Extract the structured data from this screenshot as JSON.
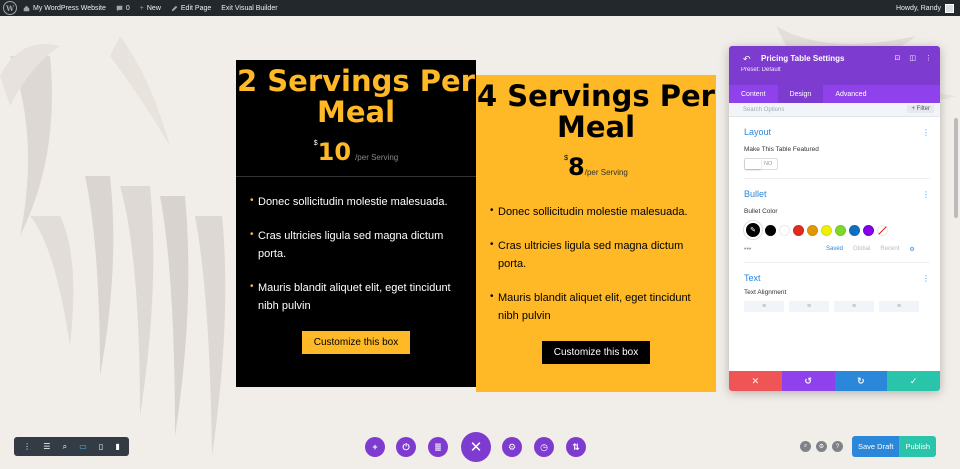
{
  "admin_bar": {
    "site_name": "My WordPress Website",
    "comments_count": "0",
    "new_label": "New",
    "edit_page_label": "Edit Page",
    "exit_builder_label": "Exit Visual Builder",
    "greeting": "Howdy, Randy"
  },
  "pricing_tables": [
    {
      "title": "2 Servings Per Meal",
      "currency": "$",
      "price": "10",
      "per": "/per Serving",
      "features": [
        "Donec sollicitudin molestie malesuada.",
        "Cras ultricies ligula sed magna dictum porta.",
        "Mauris blandit aliquet elit, eget tincidunt nibh pulvin"
      ],
      "button": "Customize this box"
    },
    {
      "title": "4 Servings Per Meal",
      "currency": "$",
      "price": "8",
      "per": "/per Serving",
      "features": [
        "Donec sollicitudin molestie malesuada.",
        "Cras ultricies ligula sed magna dictum porta.",
        "Mauris blandit aliquet elit, eget tincidunt nibh pulvin"
      ],
      "button": "Customize this box"
    }
  ],
  "settings_panel": {
    "title": "Pricing Table Settings",
    "preset": "Preset: Default",
    "tabs": [
      "Content",
      "Design",
      "Advanced"
    ],
    "active_tab": "Design",
    "search_placeholder": "Search Options",
    "filter_label": "Filter",
    "layout_section": {
      "title": "Layout",
      "featured_label": "Make This Table Featured",
      "featured_value": "NO"
    },
    "bullet_section": {
      "title": "Bullet",
      "color_label": "Bullet Color",
      "swatches": [
        "#000000",
        "#ffffff",
        "#e02b20",
        "#e09900",
        "#edf000",
        "#7cda24",
        "#0c71c3",
        "#8300e9"
      ],
      "palette_tabs": [
        "Saved",
        "Global",
        "Recent"
      ],
      "active_palette_tab": "Saved",
      "more": "•••"
    },
    "text_section": {
      "title": "Text",
      "alignment_label": "Text Alignment"
    },
    "footer_colors": [
      "#ef5555",
      "#8f42ec",
      "#2b87da",
      "#29c4a9"
    ]
  },
  "bottom_bar": {
    "save_draft": "Save Draft",
    "publish": "Publish"
  },
  "colors": {
    "accent": "#ffb926",
    "divi_purple": "#7e3bd0"
  }
}
